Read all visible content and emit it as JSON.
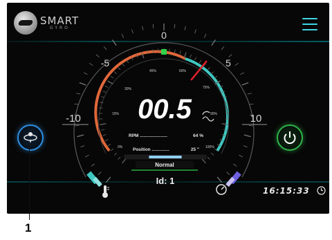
{
  "header": {
    "logo_word": "SMART",
    "logo_sub": "GYRO",
    "menu_icon": "hamburger-menu-icon"
  },
  "gauge": {
    "scale_top": "0",
    "scale_left_inner": "-5",
    "scale_right_inner": "5",
    "scale_left_outer": "-10",
    "scale_right_outer": "10",
    "percent_ticks": [
      "0%",
      "15%",
      "30%",
      "45%",
      "60%",
      "75%",
      "90%",
      "100%"
    ],
    "main_value": "00.5",
    "rpm_label": "RPM ......................",
    "rpm_value": "64 %",
    "position_label": "Position ..............",
    "position_value": "25 \"",
    "mode": "Normal",
    "id_label": "Id: 1",
    "needle_level": 0.64,
    "bar_level": 0.4
  },
  "footer": {
    "time": "16:15:33"
  },
  "callout": {
    "number": "1"
  },
  "colors": {
    "accent_cyan": "#3fd6e6",
    "gyro_blue": "#2f8fe0",
    "power_green": "#2fb34a",
    "arc_orange": "#e0683a",
    "arc_teal": "#3ec7c0",
    "needle_red": "#e0202a",
    "top_marker_green": "#2fd14a"
  }
}
